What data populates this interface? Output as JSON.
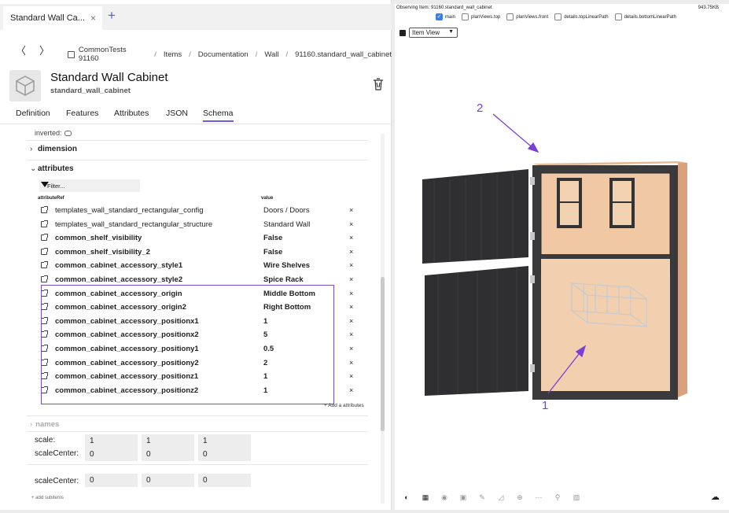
{
  "tab": {
    "title": "Standard Wall Ca...",
    "close": "×",
    "add": "+"
  },
  "nav": {
    "back": "〈",
    "forward": "〉"
  },
  "breadcrumbs": [
    "CommonTests 91160",
    "Items",
    "Documentation",
    "Wall",
    "91160.standard_wall_cabinet"
  ],
  "header": {
    "title": "Standard Wall Cabinet",
    "subtitle": "standard_wall_cabinet"
  },
  "subtabs": [
    "Definition",
    "Features",
    "Attributes",
    "JSON",
    "Schema"
  ],
  "active_subtab": "Schema",
  "schema": {
    "inverted_label": "inverted:",
    "dimension_label": "dimension",
    "attributes_label": "attributes",
    "filter_placeholder": "Filter...",
    "col_attribute": "attributeRef",
    "col_value": "value",
    "rows": [
      {
        "name": "templates_wall_standard_rectangular_config",
        "value": "Doors / Doors"
      },
      {
        "name": "templates_wall_standard_rectangular_structure",
        "value": "Standard Wall"
      },
      {
        "name": "common_shelf_visibility",
        "value": "False"
      },
      {
        "name": "common_shelf_visibility_2",
        "value": "False"
      },
      {
        "name": "common_cabinet_accessory_style1",
        "value": "Wire Shelves"
      },
      {
        "name": "common_cabinet_accessory_style2",
        "value": "Spice Rack"
      },
      {
        "name": "common_cabinet_accessory_origin",
        "value": "Middle Bottom"
      },
      {
        "name": "common_cabinet_accessory_origin2",
        "value": "Right Bottom"
      },
      {
        "name": "common_cabinet_accessory_positionx1",
        "value": "1"
      },
      {
        "name": "common_cabinet_accessory_positionx2",
        "value": "5"
      },
      {
        "name": "common_cabinet_accessory_positiony1",
        "value": "0.5"
      },
      {
        "name": "common_cabinet_accessory_positiony2",
        "value": "2"
      },
      {
        "name": "common_cabinet_accessory_positionz1",
        "value": "1"
      },
      {
        "name": "common_cabinet_accessory_positionz2",
        "value": "1"
      }
    ],
    "delete_glyph": "×",
    "add_attribute": "+ Add a attributes",
    "names_label": "names",
    "scale_label": "scale:",
    "scale_values": [
      "1",
      "1",
      "1"
    ],
    "scale_center_label": "scaleCenter:",
    "scale_center_values": [
      "0",
      "0",
      "0"
    ],
    "scale_center_label_2": "scaleCenter:",
    "scale_center_values_2": [
      "0",
      "0",
      "0"
    ],
    "add_subitems": "+ add subitems"
  },
  "viewer": {
    "observing": "Observing Item: 91160.standard_wall_cabinet",
    "size": "943.75KB",
    "views": [
      {
        "label": "main",
        "checked": true
      },
      {
        "label": "planViews.top",
        "checked": false
      },
      {
        "label": "planViews.front",
        "checked": false
      },
      {
        "label": "details.topLinearPath",
        "checked": false
      },
      {
        "label": "details.bottomLinearPath",
        "checked": false
      }
    ],
    "view_mode": "Item View",
    "annotation_1": "1",
    "annotation_2": "2",
    "toolbar_icons": [
      "palette-icon",
      "grid-icon",
      "compass-icon",
      "box-icon",
      "brush-icon",
      "ruler-icon",
      "target-icon",
      "dots-icon",
      "hierarchy-icon",
      "image-icon"
    ],
    "accent": "#7a3fd6"
  }
}
